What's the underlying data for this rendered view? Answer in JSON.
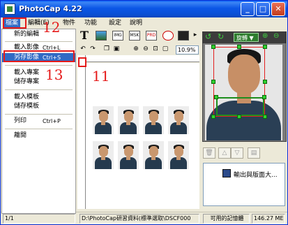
{
  "window": {
    "title": "PhotoCap 4.22",
    "min": "_",
    "max": "□",
    "close": "✕"
  },
  "menubar": {
    "file": "檔案",
    "edit": "編輯",
    "edit_tail": "(E)",
    "object": "物件",
    "function": "功能",
    "settings": "設定",
    "help": "說明"
  },
  "file_menu": {
    "new_edit": "新的編輯",
    "load_image": "載入影像",
    "load_image_sc": "Ctrl+L",
    "save_image": "另存影像",
    "save_image_sc": "Ctrl+S",
    "load_project": "載入專案",
    "save_project": "儲存專案",
    "load_template": "載入模板",
    "save_template": "儲存模板",
    "print": "列印",
    "print_sc": "Ctrl+P",
    "exit": "離開"
  },
  "toolbar": {
    "text_tool": "T",
    "img_btn": "IMG",
    "msk_btn": "MSK",
    "prd_btn": "PRD"
  },
  "zoom": "10.9%",
  "right_panel": {
    "rotate_label": "旋轉",
    "rotate_arrow": "▼",
    "list_item": "輸出與版面大..."
  },
  "status": {
    "page": "1/1",
    "path": "D:\\PhotoCap研習資料(標準選取\\DSCF000",
    "memory_label": "可用的記憶體",
    "memory_value": "146.27 ME"
  },
  "annotations": {
    "a11": "11",
    "a12": "12",
    "a13": "13"
  },
  "colors": {
    "annotation": "#E51A1A",
    "highlight": "#316AC5",
    "titlebar": "#0A50D6",
    "handle": "#2FD02F"
  }
}
